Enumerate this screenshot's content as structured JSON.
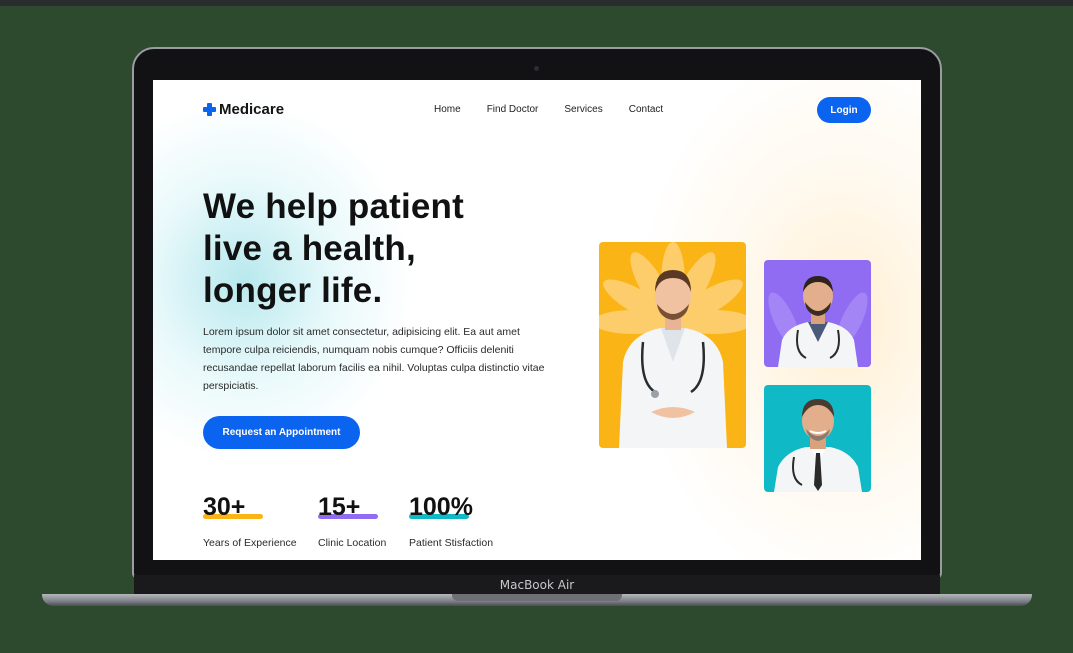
{
  "device": {
    "label": "MacBook Air"
  },
  "brand": {
    "name": "Medicare",
    "accent": "#0a64f0"
  },
  "nav": {
    "items": [
      "Home",
      "Find Doctor",
      "Services",
      "Contact"
    ],
    "login_label": "Login"
  },
  "hero": {
    "title_lines": [
      "We help patient",
      "live a health,",
      "longer life."
    ],
    "description": "Lorem ipsum dolor sit amet consectetur, adipisicing elit. Ea aut amet tempore culpa reiciendis, numquam nobis cumque? Officiis deleniti recusandae repellat laborum facilis ea nihil. Voluptas culpa distinctio vitae perspiciatis.",
    "cta_label": "Request an Appointment"
  },
  "stats": [
    {
      "value": "30+",
      "label": "Years of Experience",
      "color": "#fbb416"
    },
    {
      "value": "15+",
      "label": "Clinic Location",
      "color": "#8f6cf2"
    },
    {
      "value": "100%",
      "label": "Patient Stisfaction",
      "color": "#10b9c6"
    }
  ],
  "doctor_cards": [
    {
      "icon": "doctor-photo",
      "background": "#fbb416"
    },
    {
      "icon": "doctor-photo",
      "background": "#8f6cf2"
    },
    {
      "icon": "doctor-photo",
      "background": "#10b9c6"
    }
  ]
}
